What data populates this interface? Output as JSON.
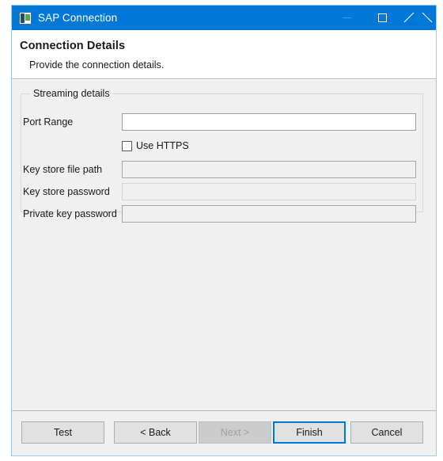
{
  "window": {
    "title": "SAP Connection",
    "icon": "sap-connection-icon",
    "border_color": "#9dc8e8",
    "titlebar_color": "#0078d7",
    "controls": [
      {
        "name": "minimize",
        "glyph": "minimize-icon",
        "disabled": true
      },
      {
        "name": "maximize",
        "glyph": "maximize-icon",
        "disabled": false
      },
      {
        "name": "close",
        "glyph": "close-icon",
        "disabled": false
      }
    ]
  },
  "header": {
    "title": "Connection Details",
    "subtitle": "Provide the connection details."
  },
  "group": {
    "label": "Streaming details",
    "fields": [
      {
        "label": "Port Range",
        "value": "",
        "placeholder": "",
        "state": "enabled"
      },
      {
        "label": "Key store file path",
        "value": "",
        "placeholder": "",
        "state": "disabled"
      },
      {
        "label": "Key store password",
        "value": "",
        "placeholder": "",
        "state": "disabled-light"
      },
      {
        "label": "Private key password",
        "value": "",
        "placeholder": "",
        "state": "disabled"
      }
    ],
    "checkbox": {
      "label": "Use HTTPS",
      "checked": false
    }
  },
  "footer": {
    "buttons": [
      {
        "label": "Test",
        "state": "enabled"
      },
      {
        "label": "< Back",
        "state": "enabled"
      },
      {
        "label": "Next >",
        "state": "disabled"
      },
      {
        "label": "Finish",
        "state": "default"
      },
      {
        "label": "Cancel",
        "state": "enabled"
      }
    ]
  }
}
